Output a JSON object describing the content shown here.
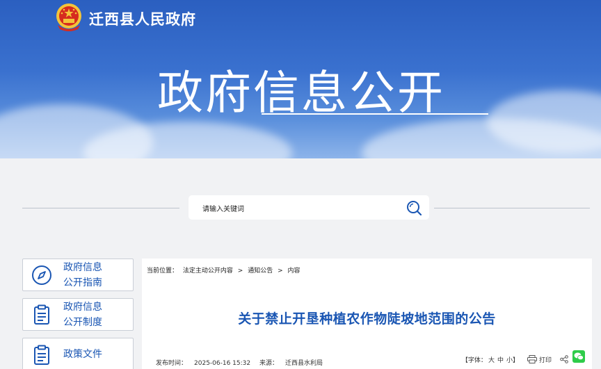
{
  "header": {
    "site_name": "迁西县人民政府",
    "banner_title": "政府信息公开"
  },
  "search": {
    "placeholder": "请输入关键词"
  },
  "sidebar": {
    "items": [
      {
        "label_line1": "政府信息",
        "label_line2": "公开指南",
        "icon": "compass-icon"
      },
      {
        "label_line1": "政府信息",
        "label_line2": "公开制度",
        "icon": "clipboard-list-icon"
      },
      {
        "label_line1": "政策文件",
        "label_line2": "",
        "icon": "clipboard-list-icon"
      }
    ]
  },
  "breadcrumb": {
    "prefix": "当前位置：",
    "items": [
      "法定主动公开内容",
      "通知公告",
      "内容"
    ],
    "separator": ">"
  },
  "article": {
    "title": "关于禁止开垦种植农作物陡坡地范围的公告",
    "publish_label": "发布时间：",
    "publish_time": "2025-06-16 15:32",
    "source_label": "来源：",
    "source": "迁西县水利局"
  },
  "tools": {
    "font_label": "【字体：",
    "font_large": "大",
    "font_medium": "中",
    "font_small": "小】",
    "print_label": "打印"
  },
  "colors": {
    "brand_blue": "#1a56b3",
    "banner_blue": "#2b5fc0",
    "wechat_green": "#2ecc4a"
  }
}
